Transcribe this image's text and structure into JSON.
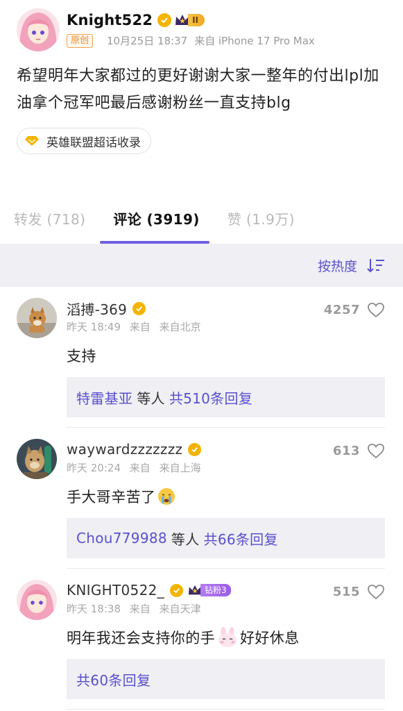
{
  "post": {
    "username": "Knight522",
    "level_badge": "II",
    "original_tag": "原创",
    "date": "10月25日 18:37",
    "source": "来自 iPhone 17 Pro Max",
    "content": "希望明年大家都过的更好谢谢大家一整年的付出lpl加油拿个冠军吧最后感谢粉丝一直支持blg",
    "topic": "英雄联盟超话收录"
  },
  "tabs": [
    {
      "label": "转发 (718)",
      "active": false
    },
    {
      "label": "评论 (3919)",
      "active": true
    },
    {
      "label": "赞 (1.9万)",
      "active": false
    }
  ],
  "sort": {
    "label": "按热度",
    "icon": "sort-icon"
  },
  "comments": [
    {
      "name": "滔搏-369",
      "time": "昨天 18:49",
      "source": "来自",
      "location": "来自北京",
      "text": "支持",
      "likes": "4257",
      "reply_users": "特雷基亚",
      "reply_mid": "等人",
      "reply_count": "共510条回复"
    },
    {
      "name": "waywardzzzzzzz",
      "time": "昨天 20:24",
      "source": "来自",
      "location": "来自上海",
      "text": "手大哥辛苦了",
      "likes": "613",
      "reply_users": "Chou779988",
      "reply_mid": "等人",
      "reply_count": "共66条回复"
    },
    {
      "name": "KNIGHT0522_",
      "fan_badge": "钻粉3",
      "time": "昨天 18:38",
      "source": "来自",
      "location": "来自天津",
      "text_a": "明年我还会支持你的手",
      "text_b": "好好休息",
      "likes": "515",
      "reply_count": "共60条回复"
    }
  ],
  "colors": {
    "accent": "#5a4fcf",
    "tab_underline": "#6e5fe0",
    "verified": "#f5b400",
    "background_gray": "#efeff4"
  }
}
